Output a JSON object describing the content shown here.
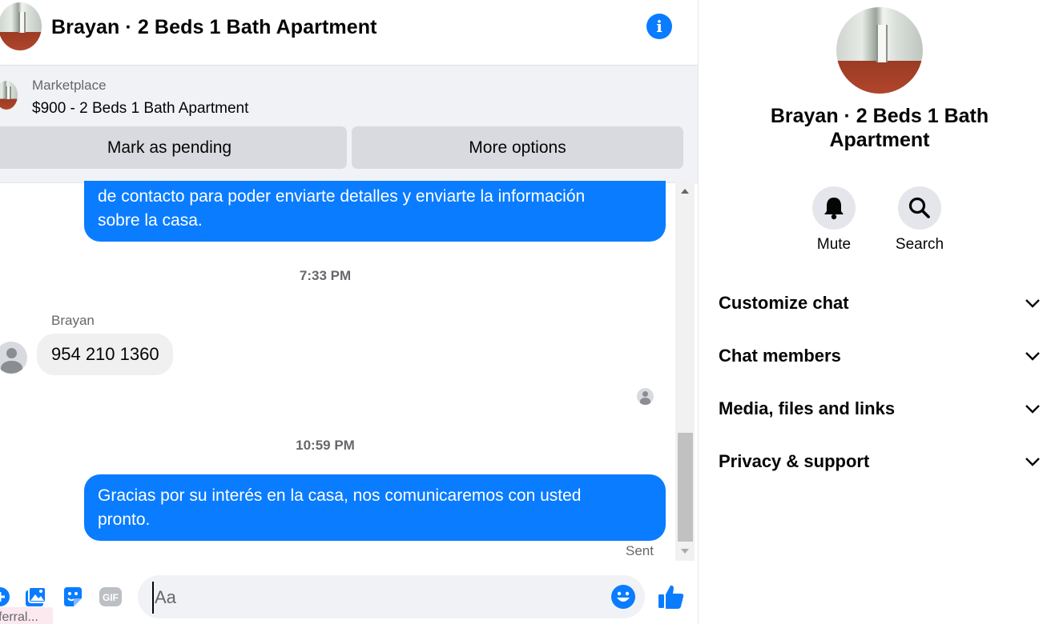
{
  "conversation": {
    "title": "Brayan · 2 Beds 1 Bath Apartment",
    "info_icon": "info-icon"
  },
  "listing": {
    "source": "Marketplace",
    "title": "$900 - 2 Beds 1 Bath Apartment",
    "mark_pending_label": "Mark as pending",
    "more_options_label": "More options"
  },
  "messages": [
    {
      "direction": "outgoing",
      "lines": [
        "de contacto para poder enviarte detalles y enviarte la información",
        "sobre la casa."
      ]
    },
    {
      "direction": "incoming",
      "sender": "Brayan",
      "text": "954 210 1360",
      "timestamp": "7:33 PM"
    },
    {
      "direction": "outgoing",
      "lines": [
        "Gracias por su interés en la casa, nos comunicaremos con usted",
        "pronto."
      ],
      "timestamp": "10:59 PM",
      "status": "Sent"
    }
  ],
  "composer": {
    "placeholder": "Aa",
    "icons": [
      "more-actions-icon",
      "photo-icon",
      "sticker-icon",
      "gif-icon",
      "emoji-icon",
      "like-icon"
    ],
    "gif_label": "GIF"
  },
  "referral_tag": "ferral...",
  "details": {
    "title_lines": [
      "Brayan · 2 Beds 1 Bath",
      "Apartment"
    ],
    "actions": [
      {
        "label": "Mute",
        "icon": "bell-icon"
      },
      {
        "label": "Search",
        "icon": "search-icon"
      }
    ],
    "sections": [
      "Customize chat",
      "Chat members",
      "Media, files and links",
      "Privacy & support"
    ]
  },
  "colors": {
    "accent": "#0a7cff",
    "bubble_incoming": "#f0f0f0",
    "panel_gray": "#f0f2f5",
    "button_gray": "#d8dadf",
    "secondary_text": "#65676b"
  }
}
